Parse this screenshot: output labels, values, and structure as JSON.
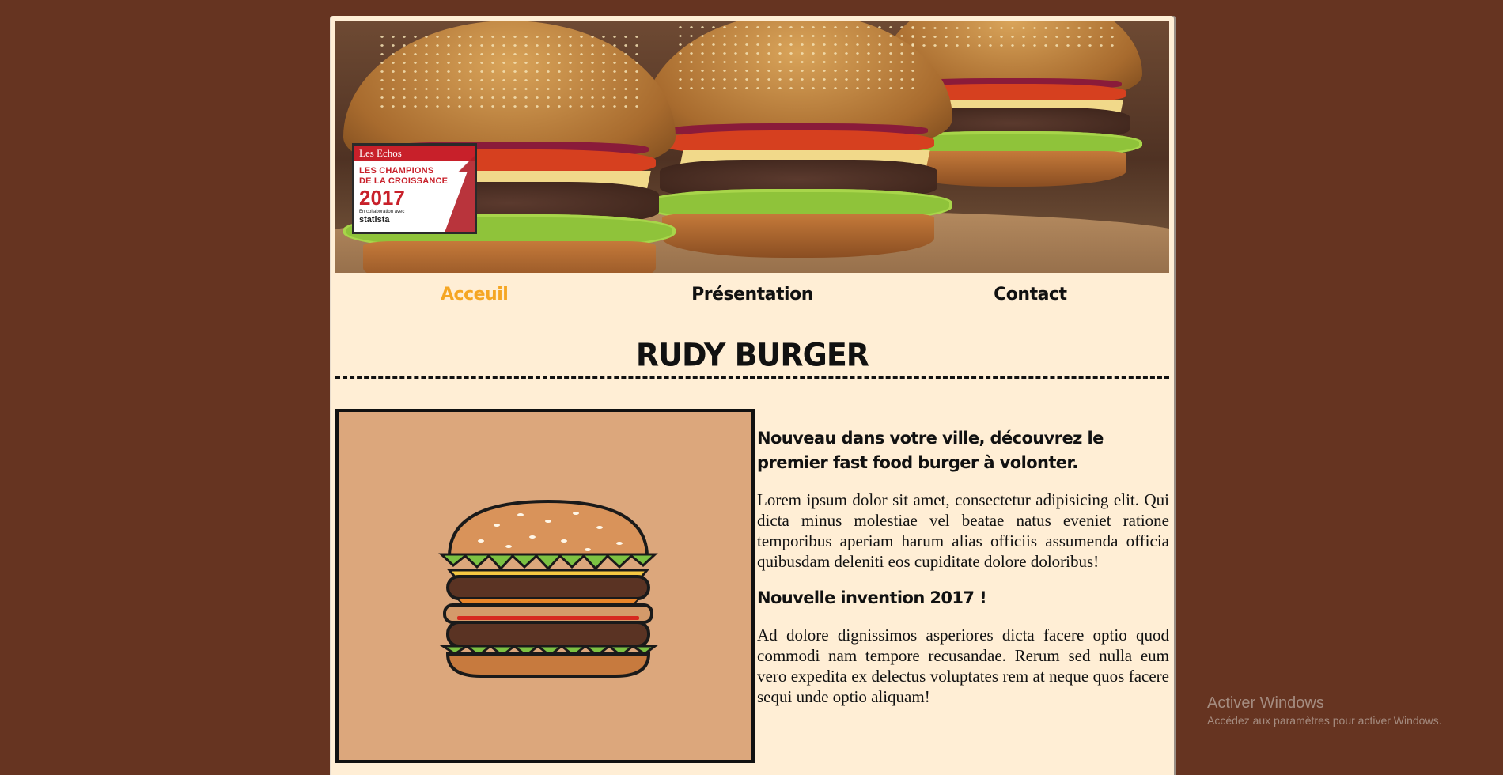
{
  "banner": {
    "badge": {
      "brand": "Les Echos",
      "line1": "LES CHAMPIONS",
      "line2": "DE LA CROISSANCE",
      "year": "2017",
      "collab": "En collaboration avec",
      "partner": "statista"
    }
  },
  "nav": {
    "items": [
      {
        "label": "Acceuil",
        "active": true
      },
      {
        "label": "Présentation",
        "active": false
      },
      {
        "label": "Contact",
        "active": false
      }
    ]
  },
  "header": {
    "title": "RUDY BURGER"
  },
  "content": {
    "heading1": "Nouveau dans votre ville, découvrez le premier fast food burger à volonter.",
    "paragraph1": "Lorem ipsum dolor sit amet, consectetur adipisicing elit. Qui dicta minus molestiae vel beatae natus eveniet ratione temporibus aperiam harum alias officiis assumenda officia quibusdam deleniti eos cupiditate dolore doloribus!",
    "heading2": "Nouvelle invention 2017 !",
    "paragraph2": "Ad dolore dignissimos asperiores dicta facere optio quod commodi nam tempore recusandae. Rerum sed nulla eum vero expedita ex delectus voluptates rem at neque quos facere sequi unde optio aliquam!"
  },
  "watermark": {
    "title": "Activer Windows",
    "subtitle": "Accédez aux paramètres pour activer Windows."
  },
  "colors": {
    "background": "#663421",
    "page": "#ffeed5",
    "nav_active": "#f5a623",
    "illustration_bg": "#dca77c"
  }
}
